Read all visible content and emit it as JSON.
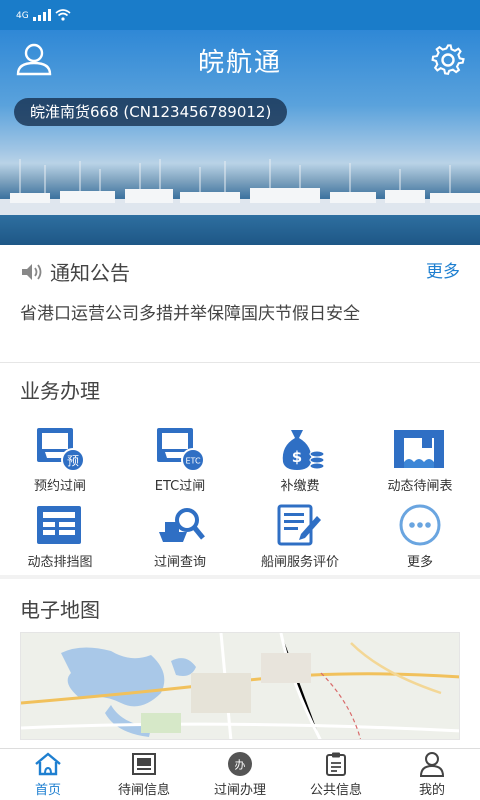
{
  "status_bar": {
    "network": "4G"
  },
  "header": {
    "title": "皖航通"
  },
  "vessel": {
    "label": "皖淮南货668 (CN123456789012)"
  },
  "notice": {
    "title": "通知公告",
    "more": "更多",
    "latest": "省港口运营公司多措并举保障国庆节假日安全"
  },
  "business": {
    "title": "业务办理",
    "items": [
      {
        "label": "预约过闸",
        "icon": "lock-booking-icon"
      },
      {
        "label": "ETC过闸",
        "icon": "etc-lock-icon"
      },
      {
        "label": "补缴费",
        "icon": "money-bag-icon"
      },
      {
        "label": "动态待闸表",
        "icon": "crane-icon"
      },
      {
        "label": "动态排挡图",
        "icon": "schedule-table-icon"
      },
      {
        "label": "过闸查询",
        "icon": "ship-search-icon"
      },
      {
        "label": "船闸服务评价",
        "icon": "edit-document-icon"
      },
      {
        "label": "更多",
        "icon": "more-dots-icon"
      }
    ]
  },
  "map": {
    "title": "电子地图"
  },
  "tabbar": {
    "tabs": [
      {
        "label": "首页",
        "active": true,
        "icon": "home-icon"
      },
      {
        "label": "待闸信息",
        "active": false,
        "icon": "gate-icon"
      },
      {
        "label": "过闸办理",
        "active": false,
        "icon": "process-icon",
        "badge": "办"
      },
      {
        "label": "公共信息",
        "active": false,
        "icon": "clipboard-icon"
      },
      {
        "label": "我的",
        "active": false,
        "icon": "profile-icon"
      }
    ]
  },
  "colors": {
    "primary": "#1e7fd0",
    "status_bar": "#1a7cc9"
  }
}
